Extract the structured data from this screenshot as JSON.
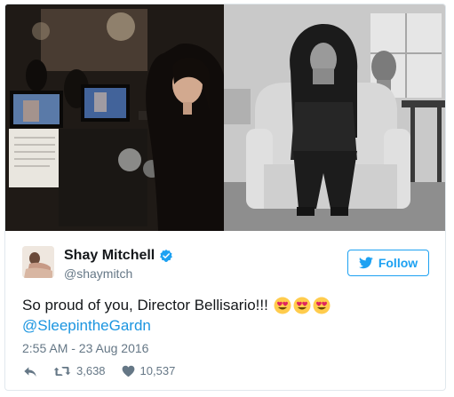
{
  "tweet": {
    "display_name": "Shay Mitchell",
    "handle": "@shaymitch",
    "text": "So proud of you, Director Bellisario!!!",
    "emojis": [
      "heart-eyes-emoji",
      "heart-eyes-emoji",
      "heart-eyes-emoji"
    ],
    "mention": "@SleepintheGardn",
    "timestamp": "2:55 AM - 23 Aug 2016",
    "retweets": "3,638",
    "likes": "10,537",
    "verified": true
  },
  "follow_button": {
    "label": "Follow"
  },
  "colors": {
    "accent": "#1da1f2",
    "mention": "#1b95e0",
    "secondary_text": "#657786",
    "border": "#e1e8ed"
  },
  "icons": {
    "verified": "verified-badge-icon",
    "follow": "twitter-bird-icon",
    "reply": "reply-icon",
    "retweet": "retweet-icon",
    "like": "heart-icon"
  }
}
